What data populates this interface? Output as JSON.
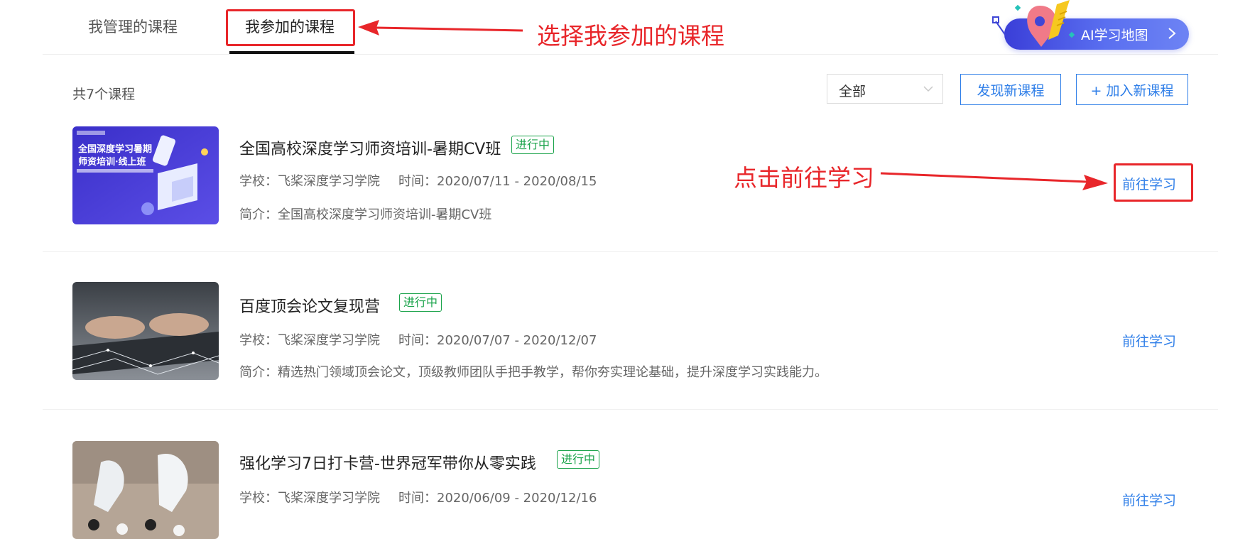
{
  "tabs": [
    {
      "label": "我管理的课程",
      "active": false
    },
    {
      "label": "我参加的课程",
      "active": true
    }
  ],
  "ai_banner": {
    "label": "AI学习地图"
  },
  "toolbar": {
    "count_text": "共7个课程",
    "filter_value": "全部",
    "discover_label": "发现新课程",
    "join_label": "+ 加入新课程"
  },
  "courses": [
    {
      "title": "全国高校深度学习师资培训-暑期CV班",
      "status": "进行中",
      "school": "学校：飞桨深度学习学院",
      "time": "时间：2020/07/11 - 2020/08/15",
      "intro": "简介：全国高校深度学习师资培训-暑期CV班",
      "action": "前往学习",
      "thumb_text": {
        "line1": "全国深度学习暑期",
        "line2": "师资培训·线上班"
      }
    },
    {
      "title": "百度顶会论文复现营",
      "status": "进行中",
      "school": "学校：飞桨深度学习学院",
      "time": "时间：2020/07/07 - 2020/12/07",
      "intro": "简介：精选热门领域顶会论文，顶级教师团队手把手教学，帮你夯实理论基础，提升深度学习实践能力。",
      "action": "前往学习"
    },
    {
      "title": "强化学习7日打卡营-世界冠军带你从零实践",
      "status": "进行中",
      "school": "学校：飞桨深度学习学院",
      "time": "时间：2020/06/09 - 2020/12/16",
      "action": "前往学习"
    }
  ],
  "annotations": {
    "select_tab": "选择我参加的课程",
    "click_go": "点击前往学习"
  },
  "colors": {
    "link_blue": "#2e7ee8",
    "status_green": "#1aa34a",
    "annotation_red": "#e8262a",
    "banner_blue": "#4a55e6"
  }
}
